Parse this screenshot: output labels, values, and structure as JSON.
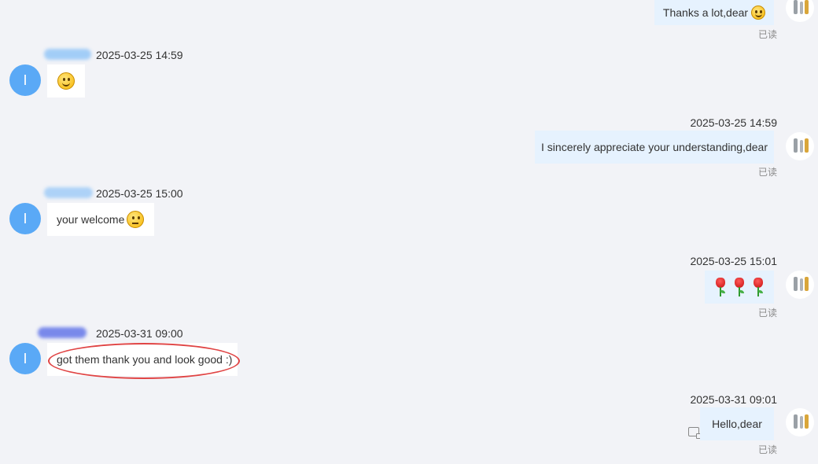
{
  "colors": {
    "page_bg": "#f2f3f7",
    "left_avatar": "#5aa9f6",
    "right_bubble": "#e6f2fe",
    "left_bubble": "#ffffff",
    "annotation_circle": "#e04444"
  },
  "left_user": {
    "avatar_letter": "I"
  },
  "read_label": "已读",
  "messages": [
    {
      "side": "right",
      "text": "Thanks a lot,dear",
      "read": "已读"
    },
    {
      "side": "left",
      "time": "2025-03-25 14:59",
      "text": "",
      "emoji": "smile-emoji"
    },
    {
      "side": "right",
      "time": "2025-03-25 14:59",
      "text": "I sincerely appreciate your understanding,dear",
      "read": "已读"
    },
    {
      "side": "left",
      "time": "2025-03-25 15:00",
      "text": "your welcome",
      "emoji": "thinking-emoji"
    },
    {
      "side": "right",
      "time": "2025-03-25 15:01",
      "text": "",
      "emoji": "rose-emoji x3",
      "read": "已读"
    },
    {
      "side": "left",
      "time": "2025-03-31 09:00",
      "text": "got them thank you and look good :)"
    },
    {
      "side": "right",
      "time": "2025-03-31 09:01",
      "text": "Hello,dear",
      "read": "已读"
    }
  ]
}
